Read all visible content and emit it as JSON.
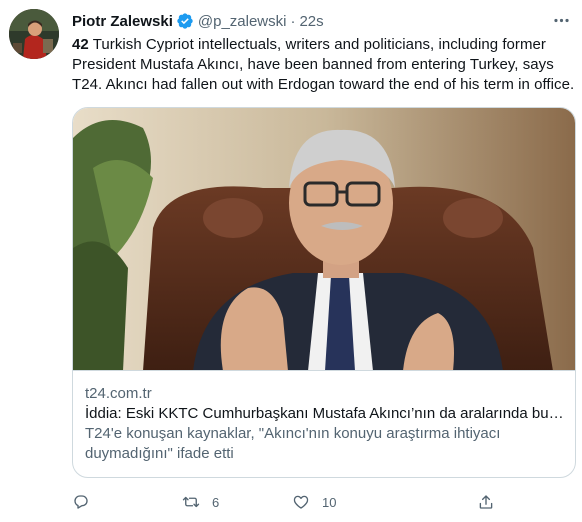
{
  "tweet": {
    "author": {
      "display_name": "Piotr Zalewski",
      "handle": "@p_zalewski",
      "verified": true,
      "avatar_icon": "profile-photo"
    },
    "separator": "·",
    "time": "22s",
    "text_bold": "42",
    "text_rest": " Turkish Cypriot intellectuals, writers and politicians, including former President Mustafa Akıncı, have been banned from entering Turkey, says T24. Akıncı had fallen out with Erdogan toward the end of his term in office."
  },
  "card": {
    "domain": "t24.com.tr",
    "title": "İddia: Eski KKTC Cumhurbaşkanı Mustafa Akıncı’nın da aralarında bul…",
    "description": "T24'e konuşan kaynaklar, \"Akıncı'nın konuyu araştırma ihtiyacı duymadığını\" ifade etti"
  },
  "actions": {
    "reply_icon": "reply-icon",
    "retweet_icon": "retweet-icon",
    "retweet_count": "6",
    "like_icon": "like-icon",
    "like_count": "10",
    "share_icon": "share-icon"
  },
  "colors": {
    "text": "#0f1419",
    "secondary": "#536471",
    "verified": "#1d9bf0",
    "border": "#cfd9de"
  }
}
